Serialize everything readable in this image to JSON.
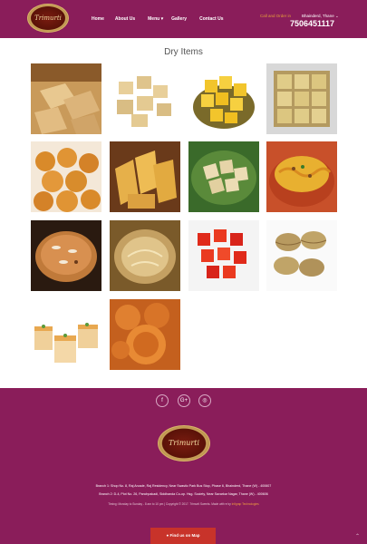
{
  "header": {
    "logo_text": "Trimurti",
    "nav": [
      "Home",
      "About Us",
      "Menu",
      "Gallery",
      "Contact Us"
    ],
    "call_label": "Call and Order in",
    "branch_label": "Bhainderd, Thane ⌄",
    "phone": "7506451117"
  },
  "page_title": "Dry Items",
  "gallery": [
    {
      "name": "kaju-katli"
    },
    {
      "name": "soan-papdi-cubes"
    },
    {
      "name": "mysore-pak"
    },
    {
      "name": "barfi-squares"
    },
    {
      "name": "balushahi"
    },
    {
      "name": "mysore-pak-stack"
    },
    {
      "name": "soan-papdi-green-plate"
    },
    {
      "name": "mixture-namkeen"
    },
    {
      "name": "dry-fruit-halwa"
    },
    {
      "name": "sweet-bowl"
    },
    {
      "name": "red-jelly-cubes"
    },
    {
      "name": "gujiya"
    },
    {
      "name": "layered-barfi"
    },
    {
      "name": "fried-kachori"
    }
  ],
  "footer": {
    "social": [
      "f",
      "G+",
      "◎"
    ],
    "logo_text": "Trimurti",
    "branch1": "Branch 1: Shop No. 8, Raj Arcade, Raj Residency, Near Swastic Park Bus Stop, Phase 6, Bhainderd, Thane (W) - 400607",
    "branch2": "Branch 2: D-4, Plot No. 26, Panchpakadi, Siddhanda Co-op. Hsg. Society, Near Savarkar Nagar, Thane (W) - 400606",
    "timing": "Timing: Monday to Sunday - 8 am to 10 pm | Copyright © 2017. Trimurti Sweets. Made with ♥ by",
    "developer": "Infigrap Technologies",
    "find_button": "Find us on Map",
    "scroll_top": "⌃"
  },
  "colors": {
    "brand": "#8a1d5a",
    "accent": "#e6a03a",
    "button": "#c8332a"
  }
}
